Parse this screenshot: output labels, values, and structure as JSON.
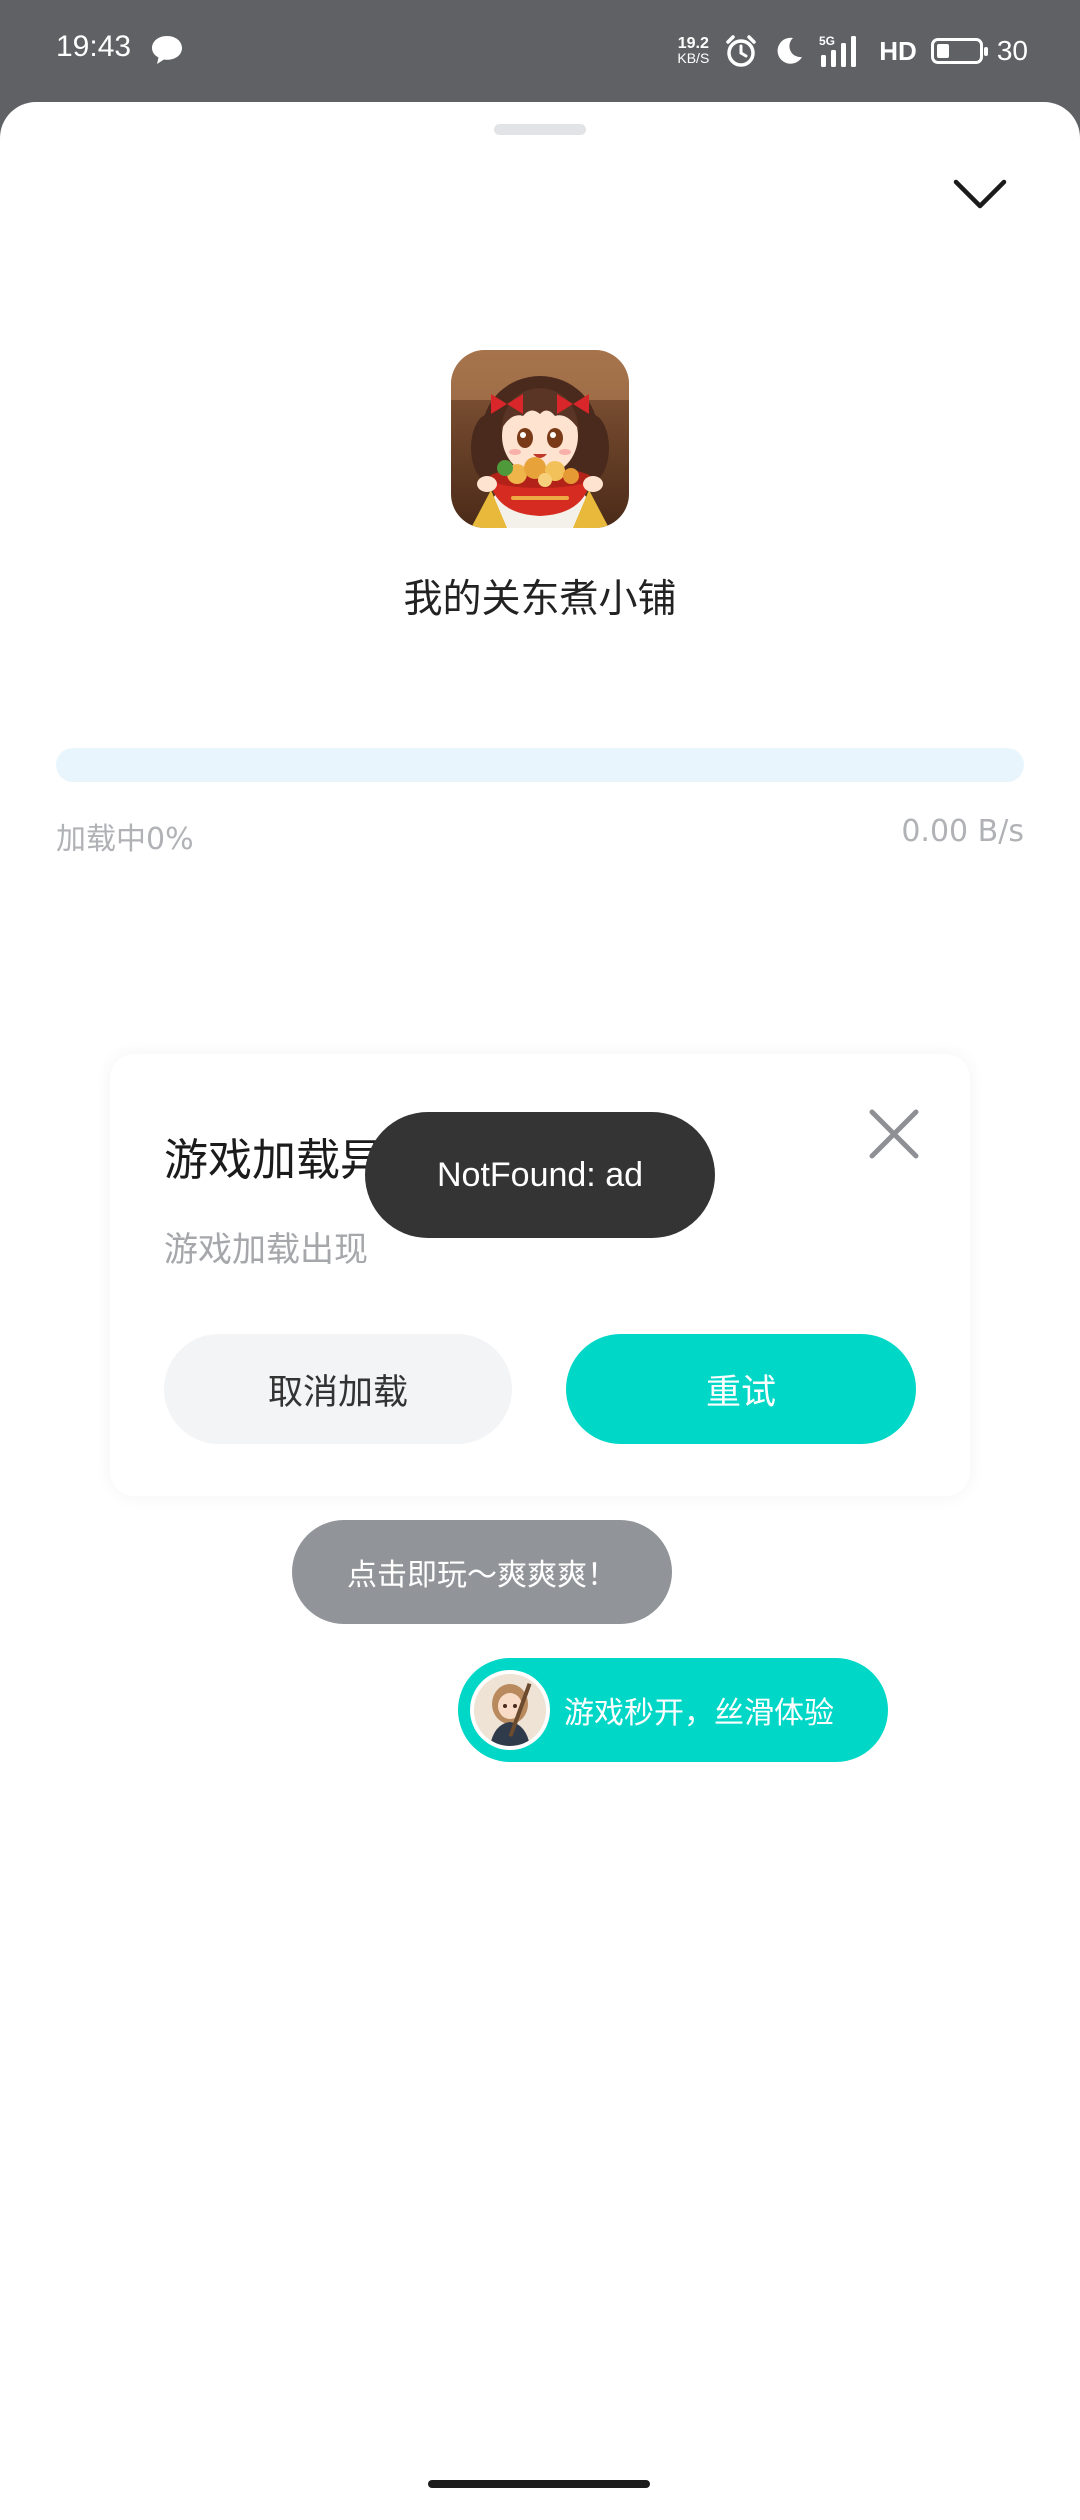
{
  "status_bar": {
    "time": "19:43",
    "net_speed_value": "19.2",
    "net_speed_unit": "KB/S",
    "hd_label": "HD",
    "battery_level": 30,
    "battery_text": "30"
  },
  "game": {
    "title": "我的关东煮小铺"
  },
  "loading": {
    "label": "加载中0%",
    "speed": "0.00 B/s",
    "progress": 0
  },
  "dialog": {
    "title": "游戏加载异常",
    "message": "游戏加载出现",
    "cancel_label": "取消加载",
    "retry_label": "重试"
  },
  "toast": {
    "text": "NotFound: ad"
  },
  "bubbles": {
    "play_text": "点击即玩～爽爽爽！",
    "feature_text": "游戏秒开，丝滑体验"
  },
  "colors": {
    "accent": "#00d7c7",
    "progress_track": "#e8f5fd",
    "toast_bg": "#343434",
    "status_bar_bg": "#5f6164"
  },
  "icons": {
    "chat": "chat-bubble-icon",
    "alarm": "alarm-icon",
    "moon": "moon-icon",
    "signal": "signal-5g-icon",
    "battery": "battery-icon",
    "collapse": "chevron-down-icon",
    "close": "close-icon"
  }
}
